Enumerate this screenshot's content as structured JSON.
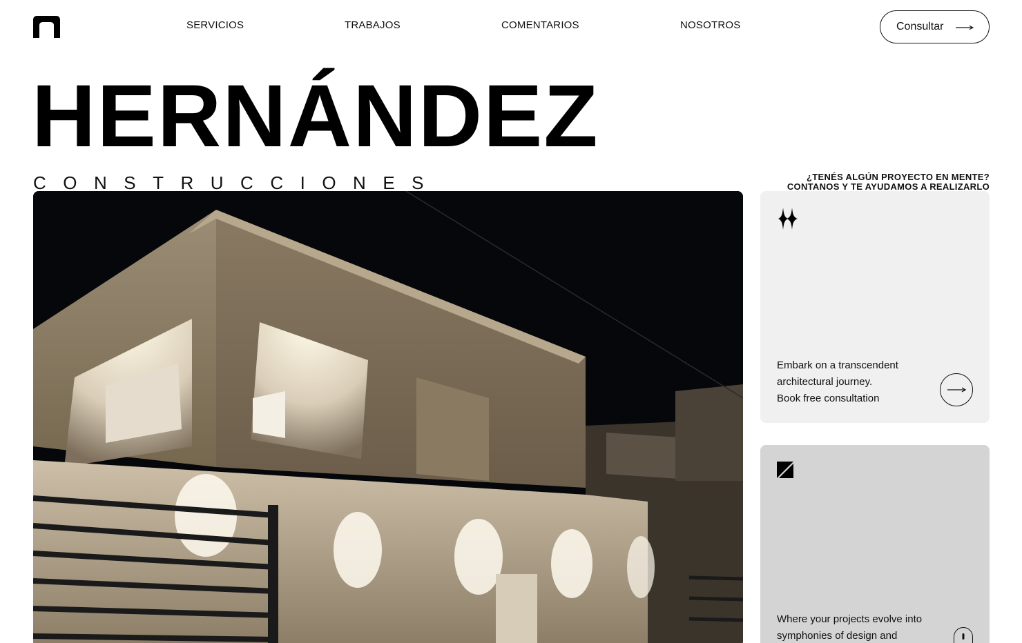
{
  "nav": {
    "logo": "brand-logo",
    "items": [
      {
        "label": "SERVICIOS"
      },
      {
        "label": "TRABAJOS"
      },
      {
        "label": "COMENTARIOS"
      },
      {
        "label": "NOSOTROS"
      }
    ],
    "cta_label": "Consultar"
  },
  "hero": {
    "title": "HERNÁNDEZ",
    "subtitle": "CONSTRUCCIONES",
    "question_line1": "¿TENÉS ALGÚN PROYECTO EN MENTE?",
    "question_line2": "CONTANOS Y TE AYUDAMOS A REALIZARLO"
  },
  "photo": {
    "icon": "house-night-photo"
  },
  "cards": [
    {
      "icon": "sparkle-icon",
      "line1": "Embark on a transcendent",
      "line2": "architectural journey.",
      "line3": "Book free consultation",
      "action_icon": "arrow-right-icon",
      "background": "#f0f0f0"
    },
    {
      "icon": "slash-square-icon",
      "line1": "Where your projects evolve into",
      "line2": "symphonies of design and",
      "action_icon": "scroll-mouse-icon",
      "background": "#d4d4d4"
    }
  ]
}
